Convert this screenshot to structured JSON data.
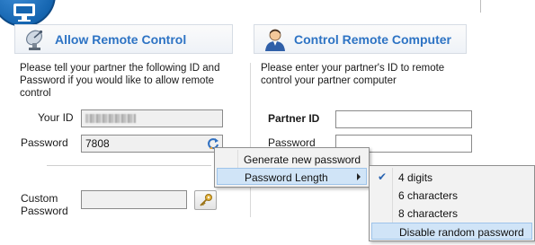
{
  "left_section": {
    "title": "Allow Remote Control",
    "description": "Please tell your partner the following ID and Password if you would like to allow remote control",
    "your_id_label": "Your ID",
    "password_label": "Password",
    "password_value": "7808",
    "custom_password_label": "Custom Password"
  },
  "right_section": {
    "title": "Control Remote Computer",
    "description": "Please enter your partner's ID to remote control your partner computer",
    "partner_id_label": "Partner ID",
    "password_label": "Password"
  },
  "context_menu": {
    "items": [
      {
        "label": "Generate new password"
      },
      {
        "label": "Password Length"
      }
    ]
  },
  "password_length_menu": {
    "items": [
      {
        "label": "4 digits",
        "checked": true
      },
      {
        "label": "6 characters",
        "checked": false
      },
      {
        "label": "8 characters",
        "checked": false
      },
      {
        "label": "Disable random password",
        "checked": false
      }
    ]
  },
  "colors": {
    "header_text": "#2d73c4",
    "highlight": "#d0e4f7",
    "app_icon": "#1565b0"
  },
  "icons": [
    "app-monitor-icon",
    "satellite-dish-icon",
    "user-icon",
    "refresh-icon",
    "key-icon",
    "check-icon",
    "submenu-arrow-icon"
  ]
}
